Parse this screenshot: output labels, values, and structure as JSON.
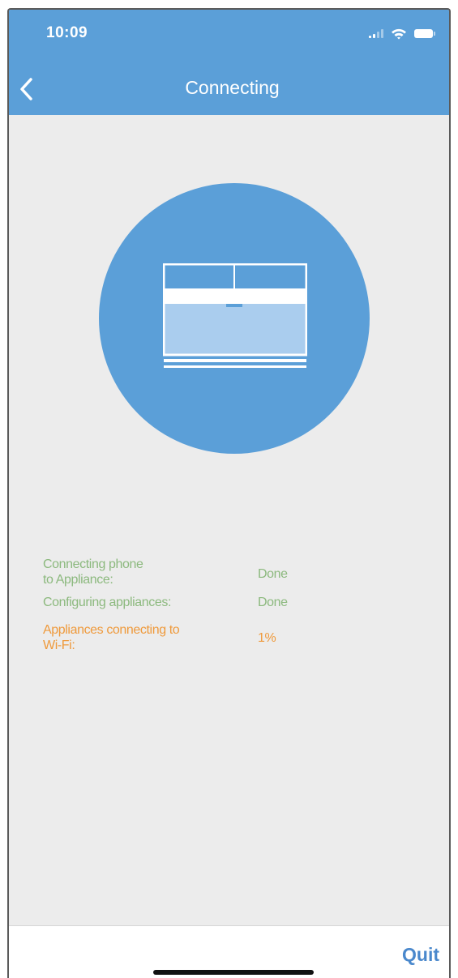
{
  "status_bar": {
    "time": "10:09",
    "icons": [
      "signal-icon",
      "wifi-icon",
      "battery-icon"
    ]
  },
  "nav": {
    "title": "Connecting",
    "back_icon": "chevron-left-icon"
  },
  "illustration": {
    "icon": "air-conditioner-icon"
  },
  "steps": [
    {
      "label": "Connecting phone\nto Appliance:",
      "status": "Done",
      "state": "done"
    },
    {
      "label": "Configuring appliances:",
      "status": "Done",
      "state": "done"
    },
    {
      "label": "Appliances connecting to\nWi-Fi:",
      "status": "1%",
      "state": "in-progress"
    }
  ],
  "footer": {
    "quit_label": "Quit"
  },
  "colors": {
    "accent": "#5b9fd8",
    "done": "#8cb97e",
    "in_progress": "#ef9a3c",
    "link": "#4a88cc"
  }
}
